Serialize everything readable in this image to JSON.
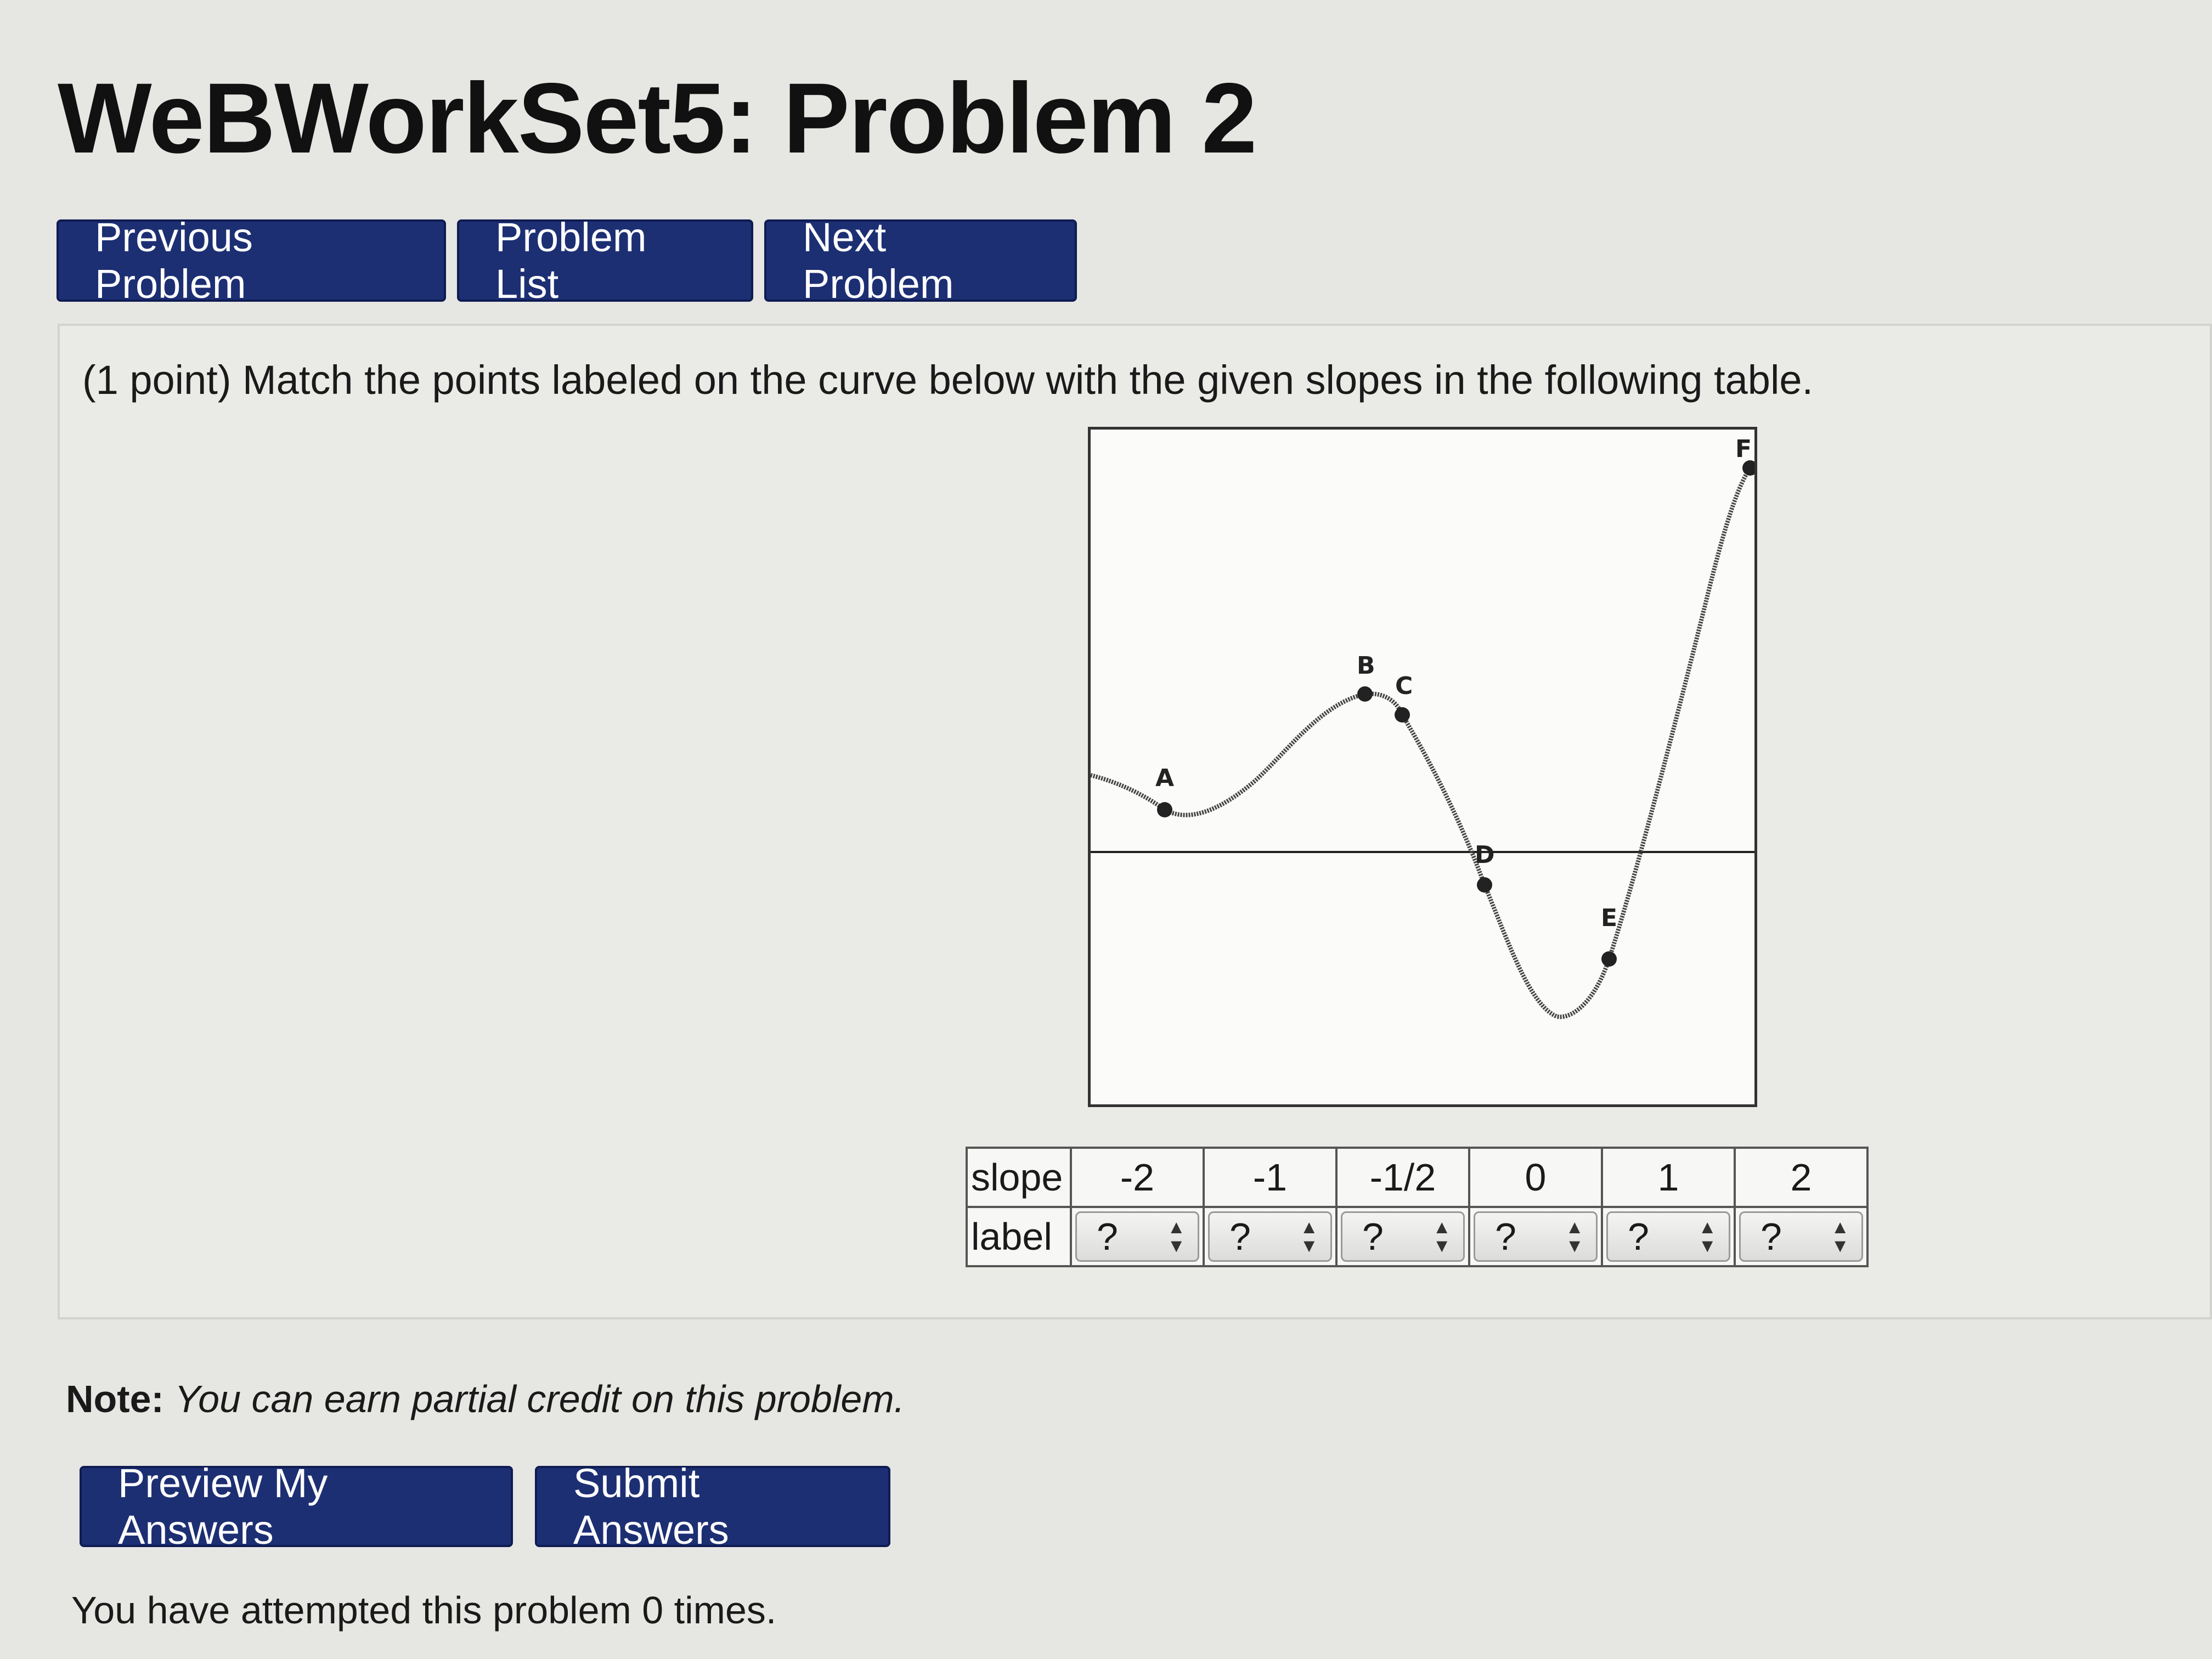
{
  "page": {
    "title": "WeBWorkSet5: Problem 2"
  },
  "nav": {
    "previous_label": "Previous Problem",
    "list_label": "Problem List",
    "next_label": "Next Problem"
  },
  "problem": {
    "text": "(1 point) Match the points labeled on the curve below with the given slopes in the following table.",
    "graph": {
      "point_labels": [
        "A",
        "B",
        "C",
        "D",
        "E",
        "F"
      ]
    }
  },
  "table": {
    "slope_header": "slope",
    "label_header": "label",
    "slopes": [
      "-2",
      "-1",
      "-1/2",
      "0",
      "1",
      "2"
    ],
    "selected_values": [
      "?",
      "?",
      "?",
      "?",
      "?",
      "?"
    ]
  },
  "note": {
    "label": "Note:",
    "text": "You can earn partial credit on this problem."
  },
  "actions": {
    "preview_label": "Preview My Answers",
    "submit_label": "Submit Answers"
  },
  "status": {
    "attempts_text": "You have attempted this problem 0 times."
  },
  "colors": {
    "button_bg": "#1d2f73",
    "button_text": "#ffffff",
    "page_bg": "#e6e6e3"
  }
}
